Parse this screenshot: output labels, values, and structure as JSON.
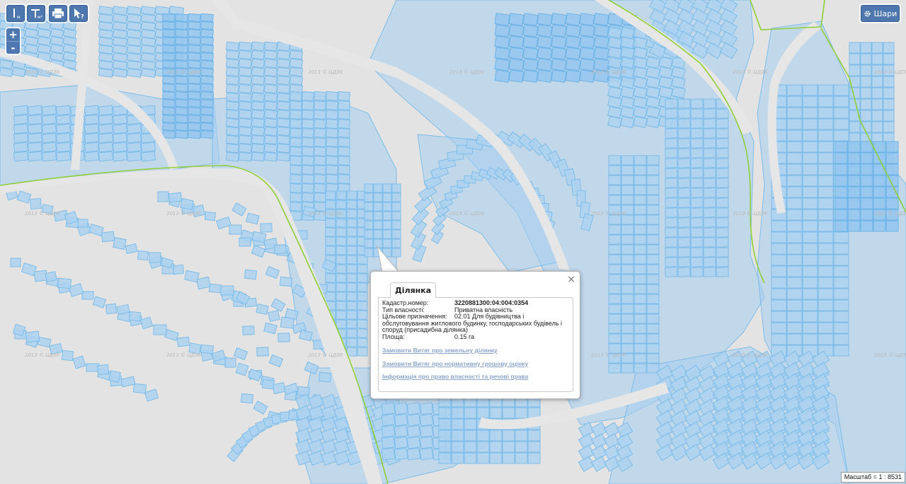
{
  "toolbar": {
    "buttons": [
      {
        "name": "measure-distance-button",
        "icon": "measure-line-icon",
        "sub": "м"
      },
      {
        "name": "measure-area-button",
        "icon": "measure-area-icon",
        "sub": "м²"
      },
      {
        "name": "print-button",
        "icon": "printer-icon"
      },
      {
        "name": "identify-button",
        "icon": "identify-cursor-icon",
        "sub": "?"
      }
    ],
    "sub_m": "м",
    "sub_m2": "м²",
    "sub_q": "?"
  },
  "zoom": {
    "in_label": "+",
    "out_label": "-"
  },
  "layers": {
    "label": "Шари",
    "icon": "gear-icon"
  },
  "watermark": "2013 © ЦДЗК",
  "popup": {
    "tab_label": "Ділянка",
    "close_label": "×",
    "fields": [
      {
        "key": "Кадастр.номер:",
        "value": "3220881300:04:004:0354",
        "bold": true
      },
      {
        "key": "Тип власності:",
        "value": "Приватна власність"
      },
      {
        "key": "Цільове призначення:",
        "value": "02.01 Для будівництва і",
        "wrap": "обслуговування житлового будинку, господарських будівель і споруд (присадибна ділянка)"
      },
      {
        "key": "Площа:",
        "value": "0.15 га"
      }
    ],
    "links": [
      "Замовити Витяг про земельну ділянку",
      "Замовити Витяг про нормативну грошову оцінку",
      "Інформація про право власності та речові права"
    ]
  },
  "scale": {
    "text": "Масштаб = 1 : 8531"
  },
  "colors": {
    "parcel_fill": "#add2f0",
    "parcel_stroke": "#7fbde8",
    "boundary": "#8fcf3a",
    "button": "#4d77ae",
    "background": "#e3e3e3"
  }
}
